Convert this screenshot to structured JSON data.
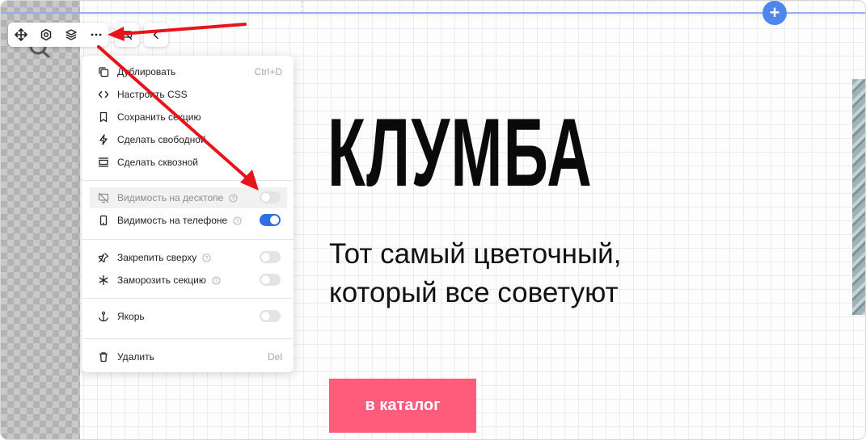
{
  "toolbar": {
    "icons": [
      "move-icon",
      "settings-icon",
      "layers-icon",
      "more-icon",
      "hide-icon",
      "chevron-left-icon"
    ]
  },
  "menu": {
    "duplicate": {
      "label": "Дублировать",
      "shortcut": "Ctrl+D"
    },
    "css": {
      "label": "Настроить CSS"
    },
    "save_section": {
      "label": "Сохранить секцию"
    },
    "make_free": {
      "label": "Сделать свободной"
    },
    "make_through": {
      "label": "Сделать сквозной"
    },
    "desktop_visibility": {
      "label": "Видимость на десктопе",
      "enabled": false
    },
    "phone_visibility": {
      "label": "Видимость на телефоне",
      "enabled": true
    },
    "pin_top": {
      "label": "Закрепить сверху",
      "enabled": false
    },
    "freeze_section": {
      "label": "Заморозить секцию",
      "enabled": false
    },
    "anchor": {
      "label": "Якорь",
      "enabled": false
    },
    "delete": {
      "label": "Удалить",
      "shortcut": "Del"
    }
  },
  "hero": {
    "title": "КЛУМБА",
    "subtitle": "Тот самый цветочный, который все советуют",
    "cta_label": "в каталог"
  },
  "colors": {
    "accent_blue": "#4f86ee",
    "toggle_on": "#2f6fe6",
    "cta": "#ff5c7c",
    "annotation_arrow": "#e8141c"
  }
}
